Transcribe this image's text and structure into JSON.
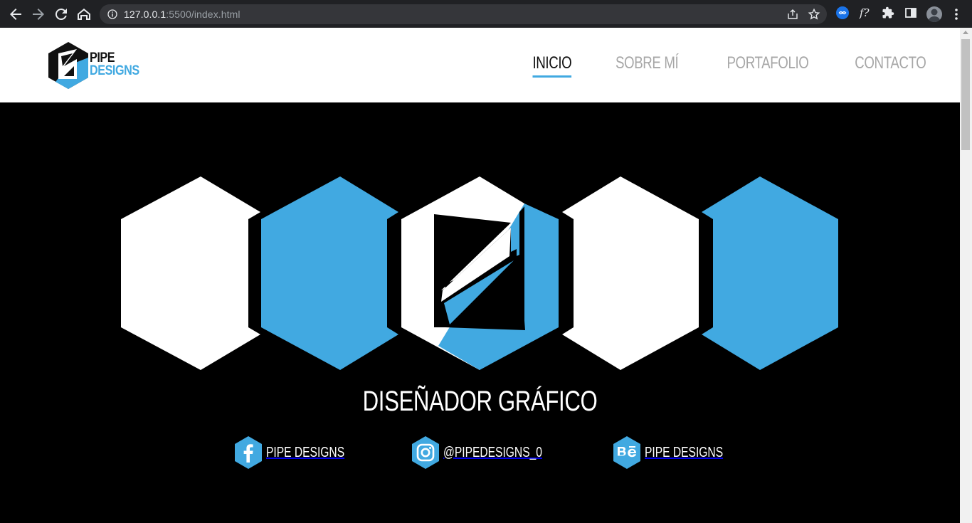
{
  "browser": {
    "url_host": "127.0.0.1",
    "url_rest": ":5500/index.html"
  },
  "header": {
    "logo_line1": "PIPE",
    "logo_line2": "DESIGNS",
    "nav": [
      {
        "label": "INICIO",
        "active": true
      },
      {
        "label": "SOBRE MÍ",
        "active": false
      },
      {
        "label": "PORTAFOLIO",
        "active": false
      },
      {
        "label": "CONTACTO",
        "active": false
      }
    ]
  },
  "hero": {
    "role": "DISEÑADOR GRÁFICO"
  },
  "social": [
    {
      "icon": "facebook-icon",
      "label": "PIPE DESIGNS"
    },
    {
      "icon": "instagram-icon",
      "label": "@PIPEDESIGNS_0"
    },
    {
      "icon": "behance-icon",
      "label": "PIPE DESIGNS"
    }
  ],
  "colors": {
    "accent": "#41a9e1",
    "nav_inactive": "#a7a7a7",
    "chrome_bg": "#202124"
  }
}
